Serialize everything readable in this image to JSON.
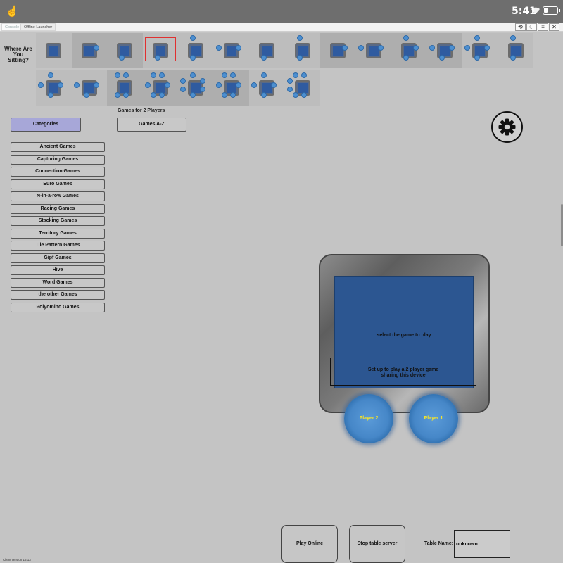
{
  "status_bar": {
    "time": "5:41",
    "icons": [
      "hand-icon",
      "wifi-icon",
      "battery-icon"
    ]
  },
  "tabs": {
    "console": "Console",
    "offline_launcher": "Offline Launcher"
  },
  "toolbar_icons": [
    "refresh-icon",
    "night-mode-icon",
    "menu-icon",
    "close-icon"
  ],
  "toolbar_glyphs": {
    "refresh": "⟲",
    "night": "☾",
    "menu": "≡",
    "close": "✕"
  },
  "seating": {
    "label_line1": "Where Are",
    "label_line2": "You Sitting?",
    "selected_index": 3,
    "row1_count": 14,
    "row2_count": 8
  },
  "games_for_label": "Games for 2 Players",
  "buttons": {
    "categories": "Categories",
    "games_az": "Games A-Z"
  },
  "categories": [
    "Ancient Games",
    "Capturing Games",
    "Connection Games",
    "Euro Games",
    "N-in-a-row Games",
    "Racing Games",
    "Stacking Games",
    "Territory Games",
    "Tile Pattern Games",
    "Gipf Games",
    "Hive",
    "Word Games",
    "the other Games",
    "Polyomino Games"
  ],
  "board": {
    "select_message": "select the game to play",
    "setup_line1": "Set up to play a 2 player game",
    "setup_line2": "sharing this device"
  },
  "players": {
    "p2": "Player 2",
    "p1": "Player 1"
  },
  "bottom": {
    "play_online": "Play Online",
    "stop_server": "Stop table server",
    "table_name_label": "Table Name:",
    "table_name_value": "unknown"
  },
  "version": "Client version 16.13",
  "colors": {
    "background": "#c4c4c4",
    "board_blue": "#2c5691",
    "categories_active": "#a7a7d8",
    "player_label": "#ffe91f"
  }
}
